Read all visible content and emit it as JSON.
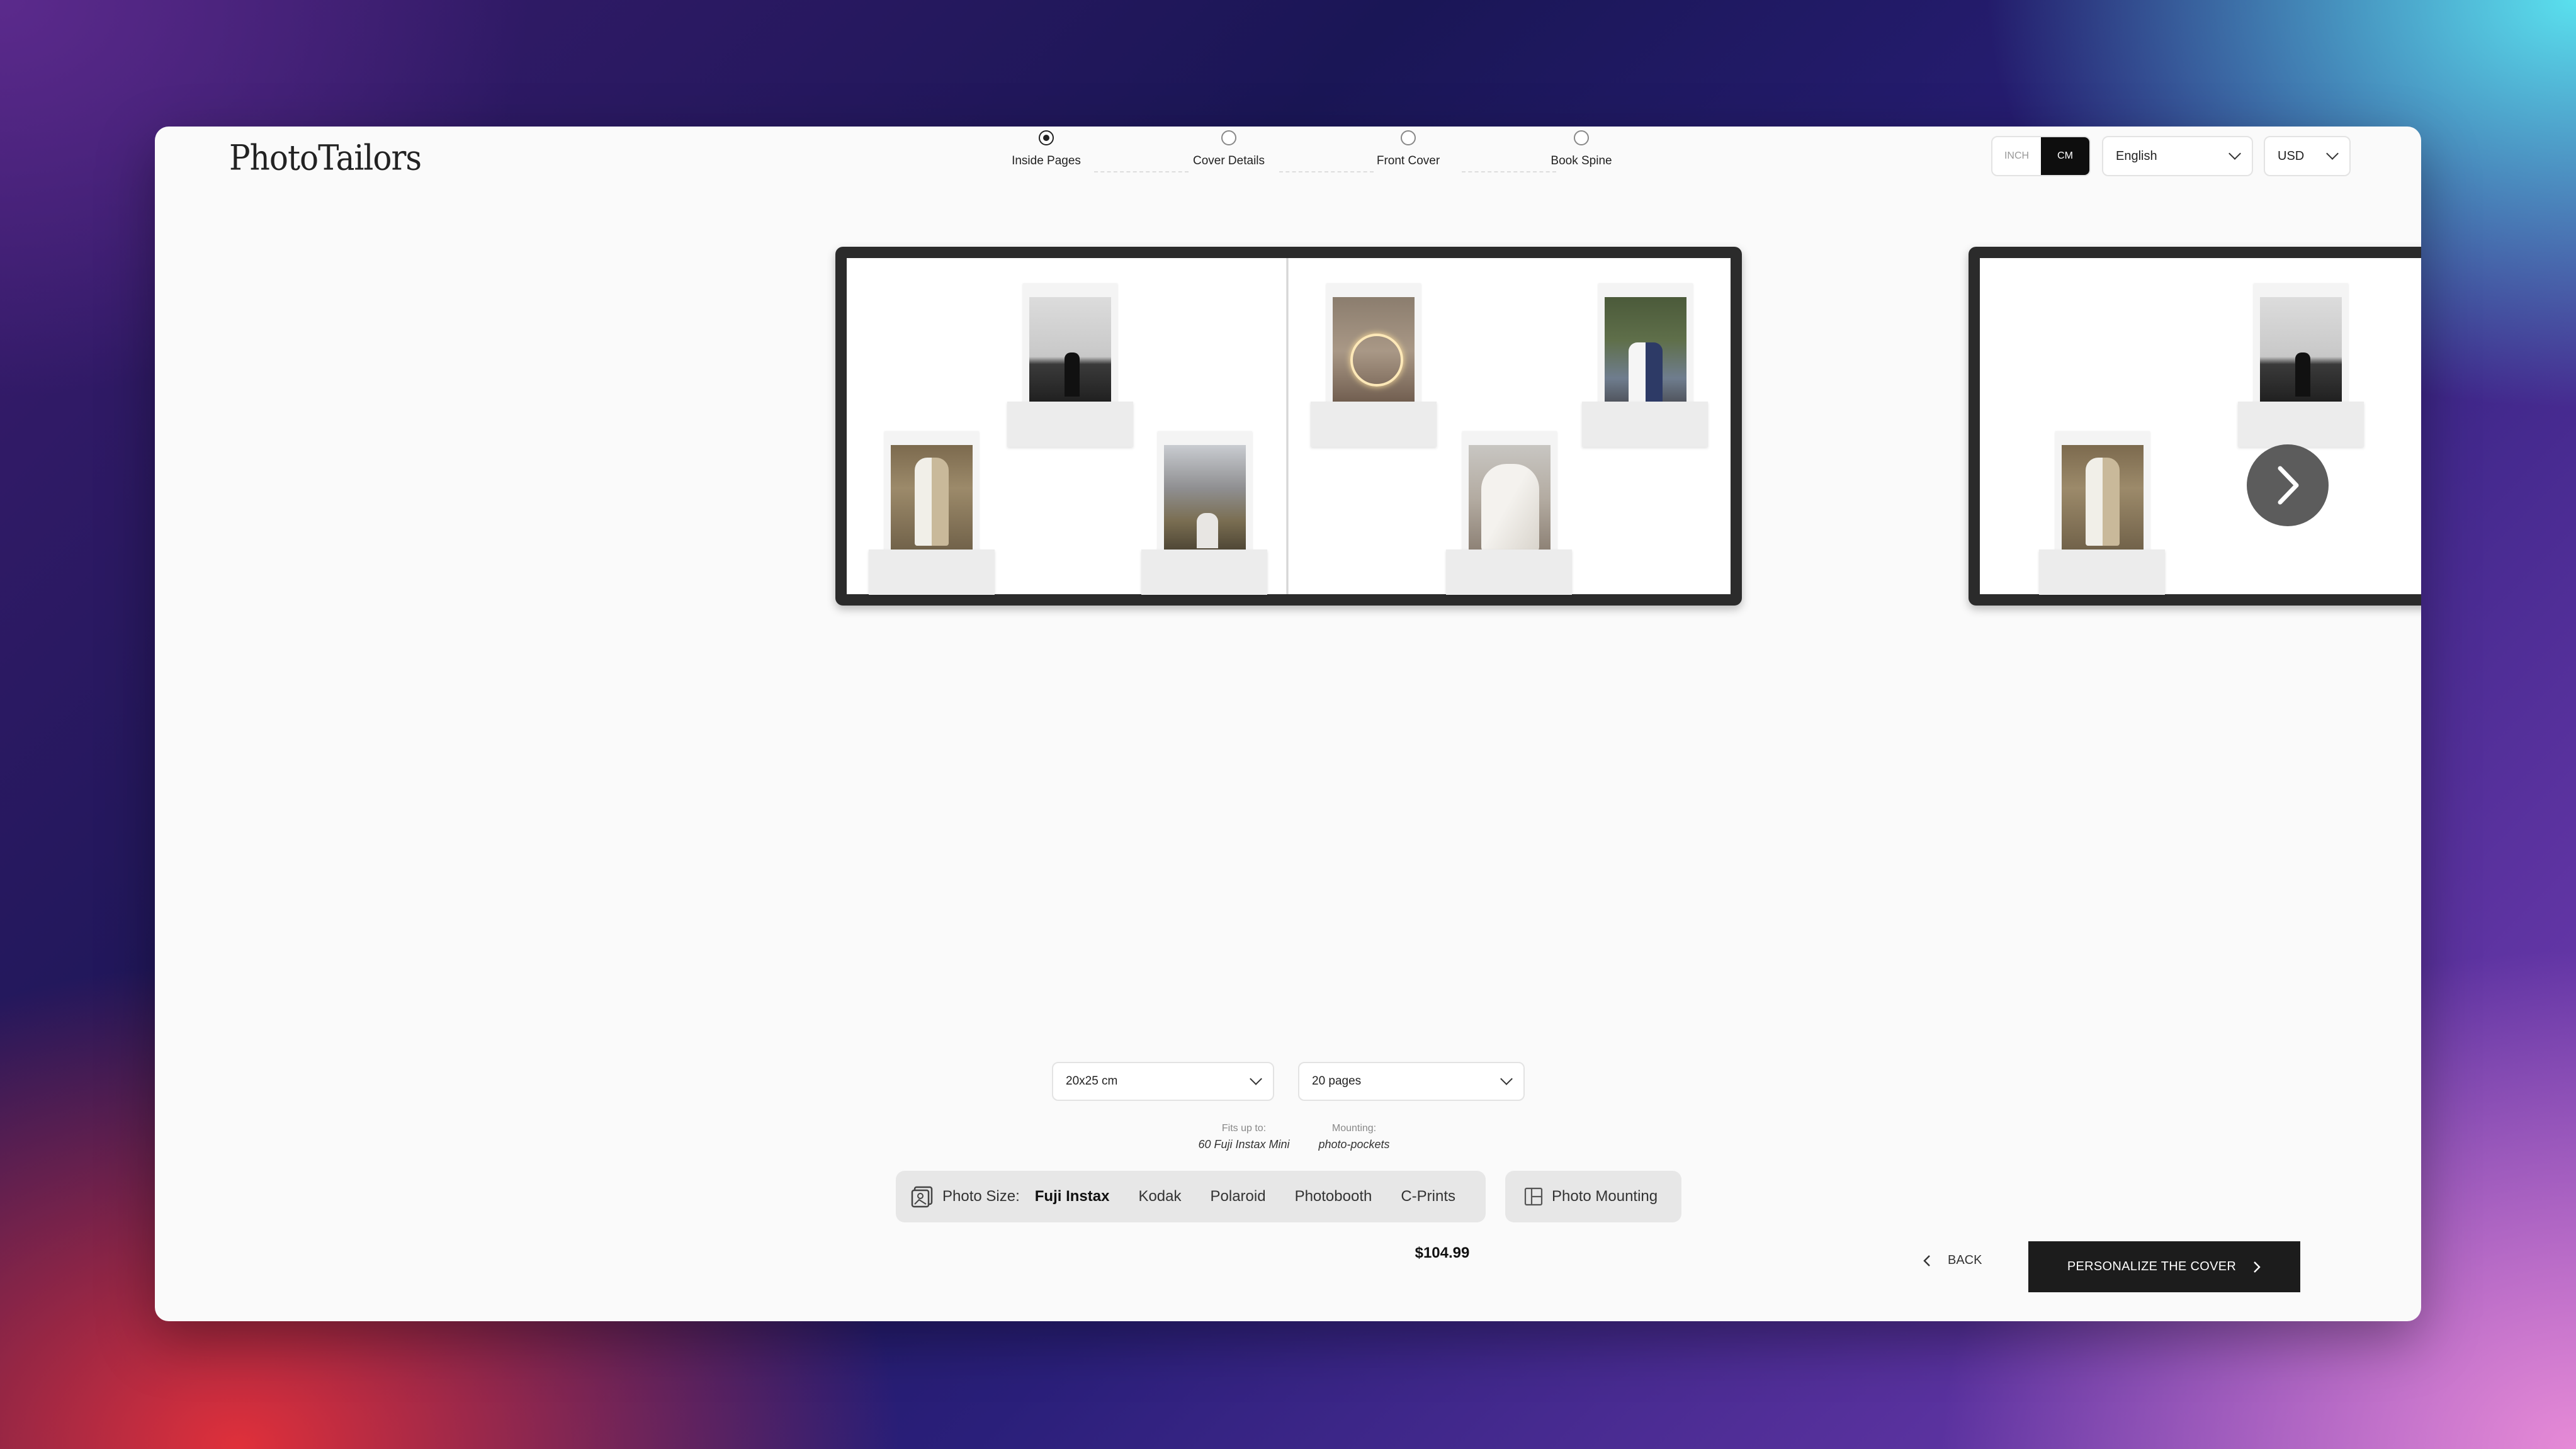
{
  "brand": {
    "logo_text": "PhotoTailors"
  },
  "stepper": {
    "steps": [
      {
        "label": "Inside Pages",
        "active": true
      },
      {
        "label": "Cover Details",
        "active": false
      },
      {
        "label": "Front Cover",
        "active": false
      },
      {
        "label": "Book Spine",
        "active": false
      }
    ]
  },
  "units": {
    "inch": "INCH",
    "cm": "CM",
    "selected": "CM"
  },
  "language": {
    "selected": "English"
  },
  "currency": {
    "selected": "USD"
  },
  "config": {
    "size": "20x25 cm",
    "pages": "20 pages",
    "fits_label": "Fits up to:",
    "fits_value": "60 Fuji Instax Mini",
    "mounting_label": "Mounting:",
    "mounting_value": "photo-pockets"
  },
  "photo_size": {
    "label": "Photo Size:",
    "options": [
      "Fuji Instax",
      "Kodak",
      "Polaroid",
      "Photobooth",
      "C-Prints"
    ],
    "selected": "Fuji Instax"
  },
  "photo_mounting": {
    "label": "Photo Mounting"
  },
  "price": "$104.99",
  "nav": {
    "back": "BACK",
    "next": "PERSONALIZE THE COVER"
  }
}
